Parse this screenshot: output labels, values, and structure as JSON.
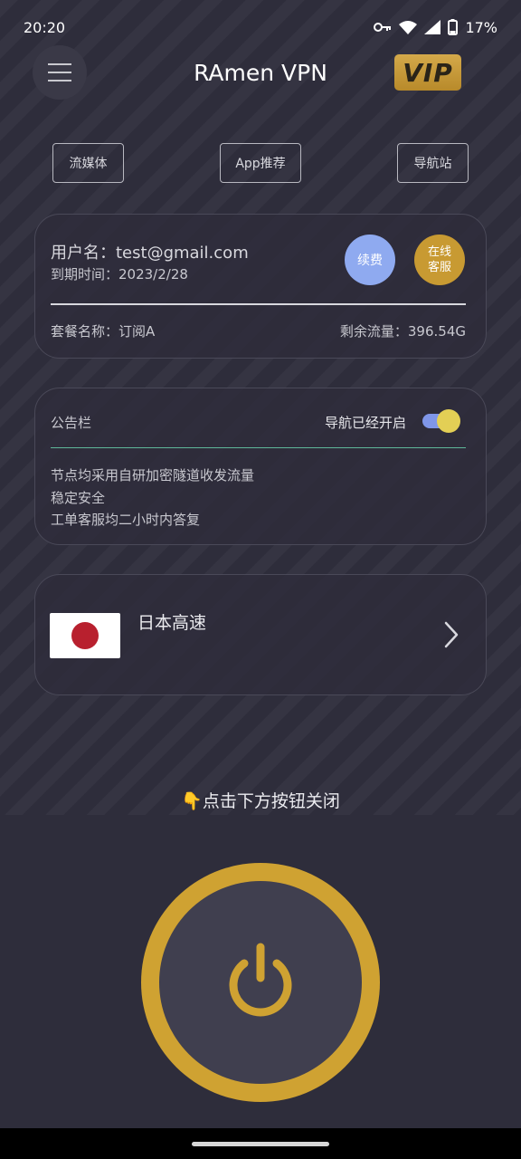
{
  "status_bar": {
    "time": "20:20",
    "battery": "17%",
    "icons": [
      "key-icon",
      "wifi-icon",
      "signal-icon",
      "battery-icon"
    ]
  },
  "header": {
    "title": "RAmen VPN",
    "vip_label": "VIP",
    "menu_icon": "menu-icon"
  },
  "quick_links": [
    "流媒体",
    "App推荐",
    "导航站"
  ],
  "user": {
    "username": "用户名：test@gmail.com",
    "expiry": "到期时间：2023/2/28",
    "renew_label": "续费",
    "support_label_line1": "在线",
    "support_label_line2": "客服",
    "plan": "套餐名称：订阅A",
    "traffic": "剩余流量：396.54G"
  },
  "notice": {
    "title": "公告栏",
    "nav_label": "导航已经开启",
    "nav_enabled": true,
    "lines": [
      "节点均采用自研加密隧道收发流量",
      "稳定安全",
      "工单客服均二小时内答复"
    ]
  },
  "server": {
    "name": "日本高速",
    "flag_icon": "japan-flag-icon"
  },
  "connect": {
    "hint": "👇点击下方按钮关闭",
    "button_icon": "power-icon"
  },
  "colors": {
    "background": "#2e2d3b",
    "gold": "#cfa232",
    "renew_blue": "#8faaf0",
    "toggle_knob": "#e3cf55"
  }
}
